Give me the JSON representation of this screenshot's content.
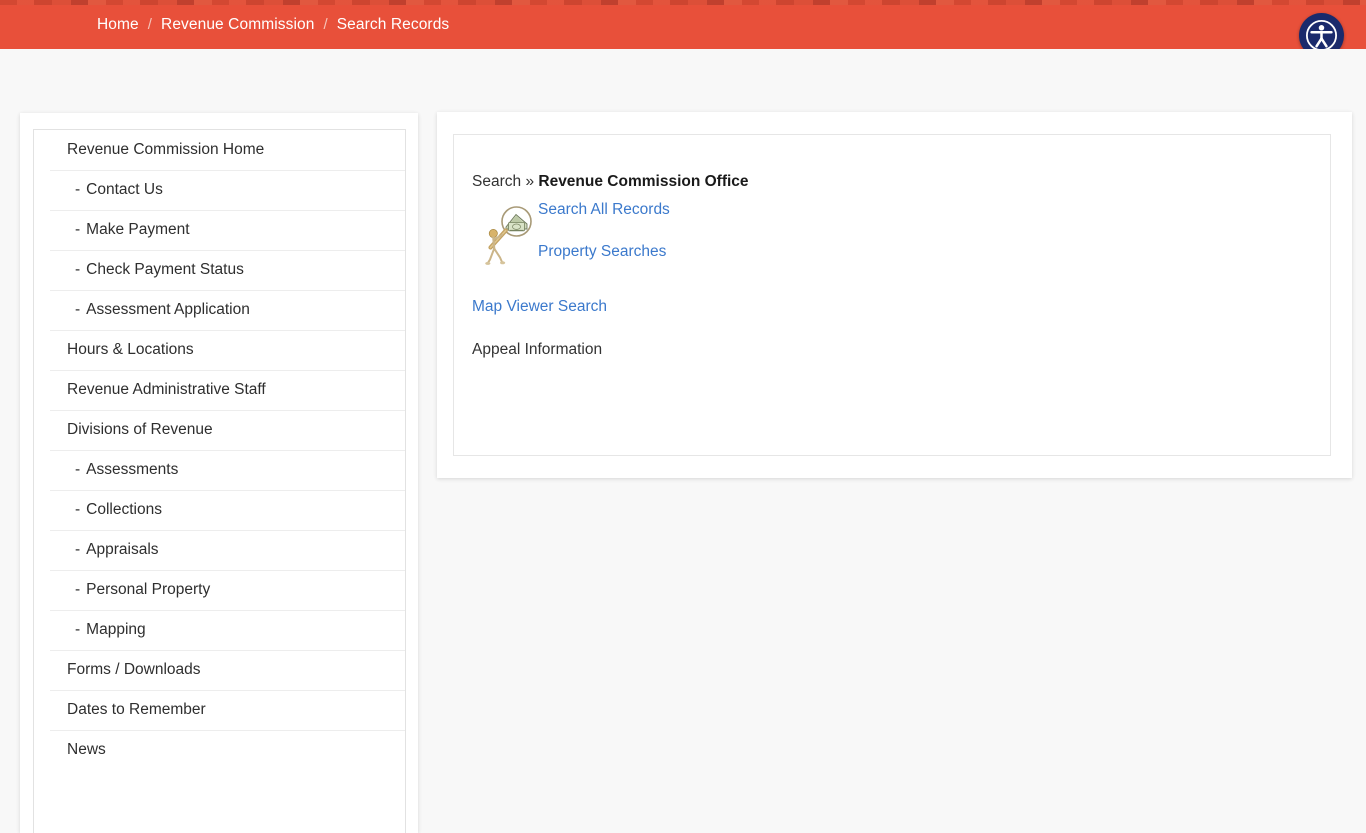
{
  "topbar": {
    "background_color": "#e8503a",
    "separator": "/",
    "breadcrumb": [
      {
        "label": "Home"
      },
      {
        "label": "Revenue Commission"
      },
      {
        "label": "Search Records"
      }
    ],
    "accessibility_button": {
      "icon": "accessibility-person-icon",
      "label": "Accessibility options",
      "background_color": "#1a2a6c"
    }
  },
  "sidebar": {
    "items": [
      {
        "label": "Revenue Commission Home",
        "sub": false
      },
      {
        "label": "Contact Us",
        "sub": true,
        "dash": "-"
      },
      {
        "label": "Make Payment",
        "sub": true,
        "dash": "-"
      },
      {
        "label": "Check Payment Status",
        "sub": true,
        "dash": "-"
      },
      {
        "label": "Assessment Application",
        "sub": true,
        "dash": "-"
      },
      {
        "label": "Hours & Locations",
        "sub": false
      },
      {
        "label": "Revenue Administrative Staff",
        "sub": false
      },
      {
        "label": "Divisions of Revenue",
        "sub": false
      },
      {
        "label": "Assessments",
        "sub": true,
        "dash": "-"
      },
      {
        "label": "Collections",
        "sub": true,
        "dash": "-"
      },
      {
        "label": "Appraisals",
        "sub": true,
        "dash": "-"
      },
      {
        "label": "Personal Property",
        "sub": true,
        "dash": "-"
      },
      {
        "label": "Mapping",
        "sub": true,
        "dash": "-"
      },
      {
        "label": "Forms / Downloads",
        "sub": false
      },
      {
        "label": "Dates to Remember",
        "sub": false
      },
      {
        "label": "News",
        "sub": false
      }
    ]
  },
  "main": {
    "heading_prefix": "Search",
    "heading_separator": "»",
    "heading_title": "Revenue Commission Office",
    "search_icon_name": "magnifying-glass-money-icon",
    "links": {
      "search_all_records": "Search All Records",
      "property_searches": "Property Searches",
      "map_viewer_search": "Map Viewer Search"
    },
    "appeal_information": "Appeal Information",
    "link_color": "#3b79cc",
    "text_color": "#333333"
  }
}
